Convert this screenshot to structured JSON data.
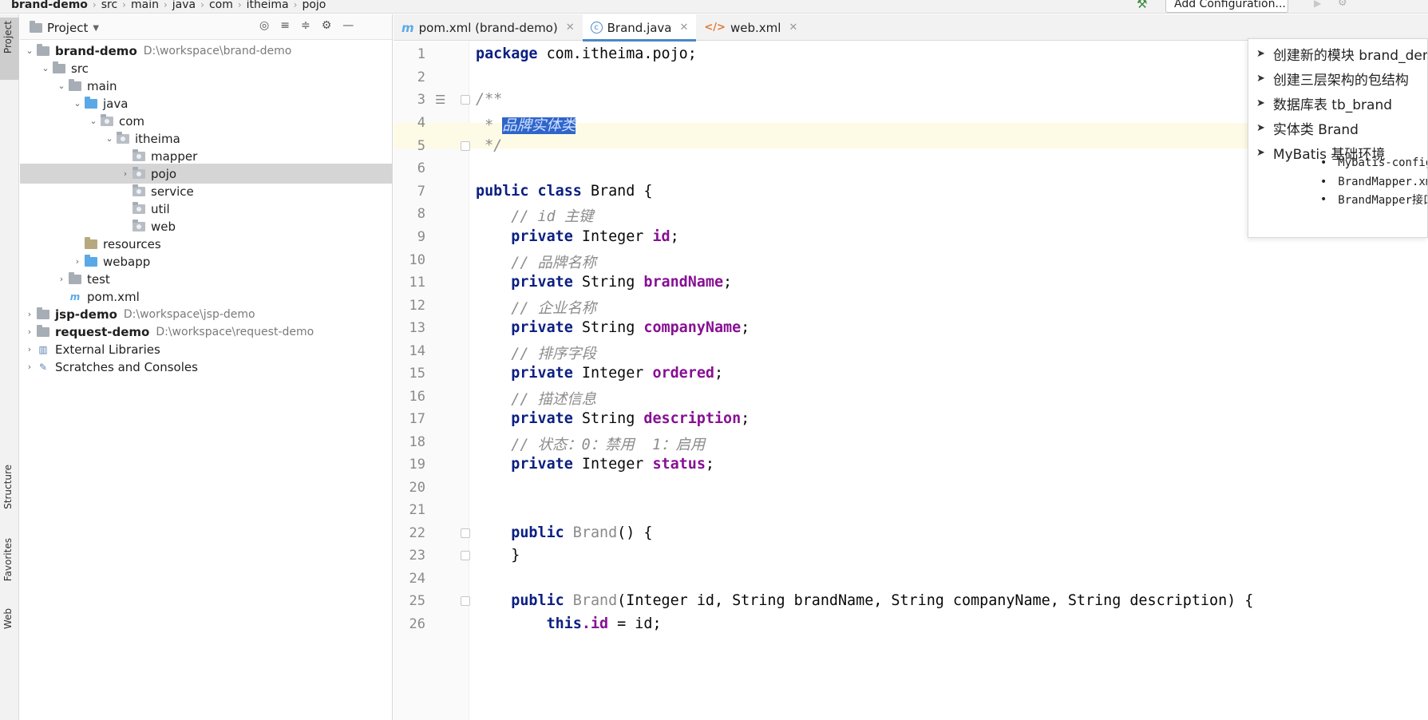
{
  "breadcrumb": [
    "brand-demo",
    "src",
    "main",
    "java",
    "com",
    "itheima",
    "pojo"
  ],
  "toolbar": {
    "add_configuration": "Add Configuration..."
  },
  "left_strip": {
    "project": "Project",
    "structure": "Structure",
    "favorites": "Favorites",
    "web": "Web"
  },
  "project_panel": {
    "title": "Project"
  },
  "tree": [
    {
      "label": "brand-demo",
      "path": "D:\\workspace\\brand-demo"
    },
    {
      "label": "src"
    },
    {
      "label": "main"
    },
    {
      "label": "java"
    },
    {
      "label": "com"
    },
    {
      "label": "itheima"
    },
    {
      "label": "mapper"
    },
    {
      "label": "pojo"
    },
    {
      "label": "service"
    },
    {
      "label": "util"
    },
    {
      "label": "web"
    },
    {
      "label": "resources"
    },
    {
      "label": "webapp"
    },
    {
      "label": "test"
    },
    {
      "label": "pom.xml"
    },
    {
      "label": "jsp-demo",
      "path": "D:\\workspace\\jsp-demo"
    },
    {
      "label": "request-demo",
      "path": "D:\\workspace\\request-demo"
    },
    {
      "label": "External Libraries"
    },
    {
      "label": "Scratches and Consoles"
    }
  ],
  "tabs": [
    {
      "label": "pom.xml (brand-demo)"
    },
    {
      "label": "Brand.java"
    },
    {
      "label": "web.xml"
    }
  ],
  "code": {
    "line_numbers": [
      "1",
      "2",
      "3",
      "4",
      "5",
      "6",
      "7",
      "8",
      "9",
      "10",
      "11",
      "12",
      "13",
      "14",
      "15",
      "16",
      "17",
      "18",
      "19",
      "20",
      "21",
      "22",
      "23",
      "24",
      "25",
      "26"
    ],
    "l1_kw": "package",
    "l1_rest": " com.itheima.pojo;",
    "l3": "/**",
    "l4_star": " * ",
    "l4_sel": "品牌实体类",
    "l5": " */",
    "l7_kw": "public class",
    "l7_rest": " Brand {",
    "l8": "    // id 主键",
    "l9_kw": "    private",
    "l9_type": " Integer ",
    "l9_field": "id",
    "l9_end": ";",
    "l10": "    // 品牌名称",
    "l11_kw": "    private",
    "l11_type": " String ",
    "l11_field": "brandName",
    "l11_end": ";",
    "l12": "    // 企业名称",
    "l13_kw": "    private",
    "l13_type": " String ",
    "l13_field": "companyName",
    "l13_end": ";",
    "l14": "    // 排序字段",
    "l15_kw": "    private",
    "l15_type": " Integer ",
    "l15_field": "ordered",
    "l15_end": ";",
    "l16": "    // 描述信息",
    "l17_kw": "    private",
    "l17_type": " String ",
    "l17_field": "description",
    "l17_end": ";",
    "l18": "    // 状态：0：禁用  1：启用",
    "l19_kw": "    private",
    "l19_type": " Integer ",
    "l19_field": "status",
    "l19_end": ";",
    "l22_kw": "    public",
    "l22_name": " Brand",
    "l22_rest": "() {",
    "l23": "    }",
    "l25_kw": "    public",
    "l25_name": " Brand",
    "l25_rest": "(Integer id, String brandName, String companyName, String description) {",
    "l26_kw": "        this",
    "l26_field": ".id",
    "l26_rest": " = id;"
  },
  "notes": {
    "items": [
      "创建新的模块 brand_demo",
      "创建三层架构的包结构",
      "数据库表 tb_brand",
      "实体类 Brand",
      "MyBatis 基础环境"
    ],
    "subitems": [
      "Mybatis-config.xml",
      "BrandMapper.xml",
      "BrandMapper接口"
    ]
  }
}
